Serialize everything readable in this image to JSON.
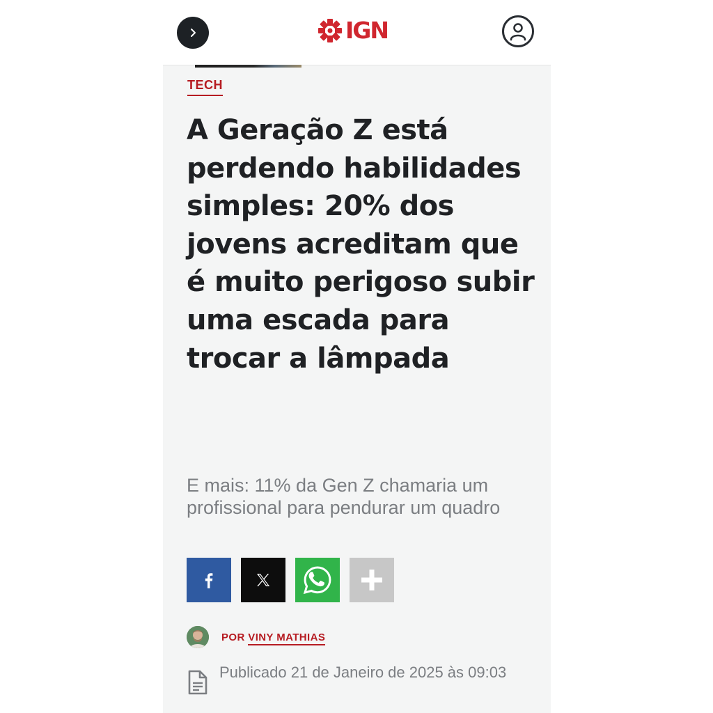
{
  "header": {
    "menu_icon": "chevron-right-icon",
    "logo_text": "IGN",
    "logo_icon": "ign-burst-icon",
    "profile_icon": "user-icon"
  },
  "article": {
    "category": "TECH",
    "title": "A Geração Z está perdendo habilidades simples: 20% dos jovens acreditam que é muito perigoso subir uma escada para trocar a lâmpada",
    "subtitle": "E mais: 11% da Gen Z chamaria um profissional para pendurar um quadro"
  },
  "share": {
    "buttons": [
      {
        "icon": "facebook-icon",
        "color": "#2f5aa1"
      },
      {
        "icon": "x-icon",
        "color": "#0d0d0d"
      },
      {
        "icon": "whatsapp-icon",
        "color": "#31b44a"
      },
      {
        "icon": "plus-icon",
        "color": "#c7c7c7"
      }
    ]
  },
  "author": {
    "prefix": "POR",
    "name": "VINY MATHIAS"
  },
  "published": {
    "icon": "document-icon",
    "text": "Publicado 21 de Janeiro de 2025 às 09:03"
  },
  "colors": {
    "brand_red": "#d0262e",
    "category_red": "#b61c22",
    "headline": "#1f2124",
    "muted_text": "#7b7e82",
    "page_bg": "#f4f5f5"
  }
}
